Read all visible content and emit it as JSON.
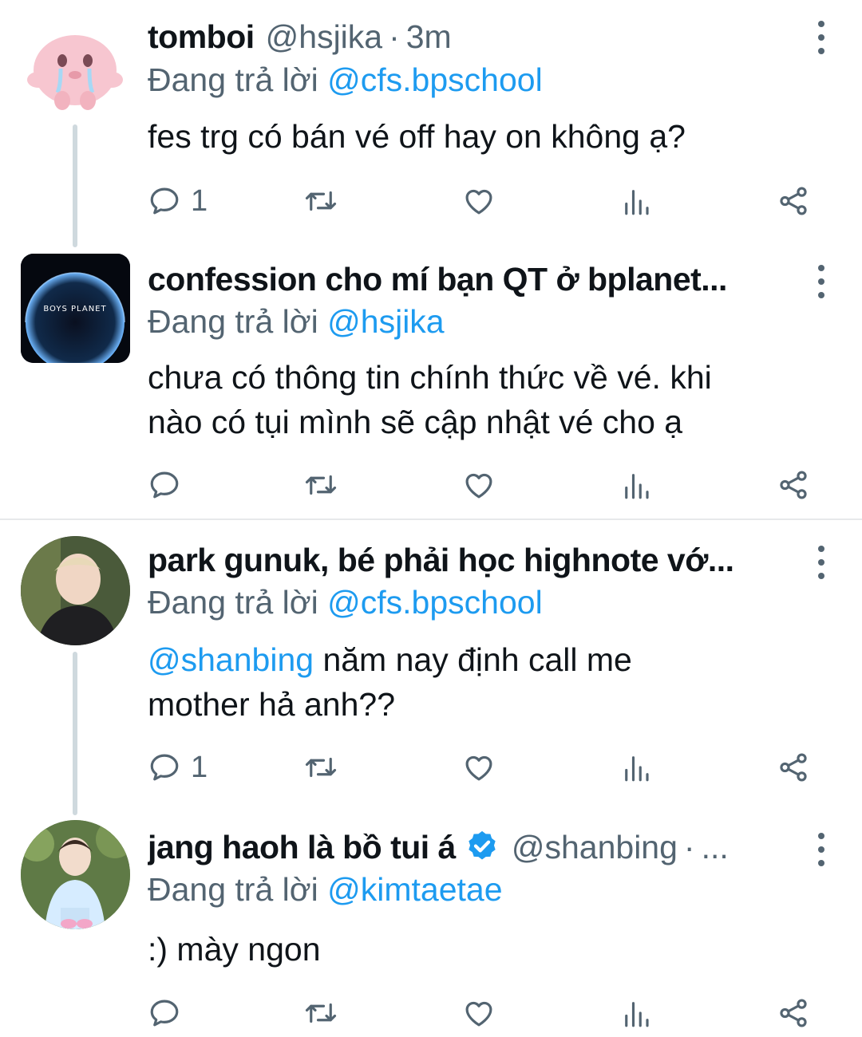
{
  "tweets": [
    {
      "name": "tomboi",
      "handle": "@hsjika",
      "dot": "·",
      "time": "3m",
      "reply_prefix": "Đang trả lời",
      "reply_to": "@cfs.bpschool",
      "text": "fes trg có bán vé off hay on không ạ?",
      "reply_count": "1"
    },
    {
      "name": "confession cho mí bạn QT ở bplanet...",
      "reply_prefix": "Đang trả lời",
      "reply_to": "@hsjika",
      "text_line1": "chưa có thông tin chính thức về vé. khi",
      "text_line2": "nào có tụi mình sẽ cập nhật vé cho ạ",
      "avatar_text": "BOYS PLANET"
    },
    {
      "name": "park gunuk, bé phải học highnote vớ...",
      "reply_prefix": "Đang trả lời",
      "reply_to": "@cfs.bpschool",
      "mention": "@shanbing",
      "text_line1_rest": " năm nay định call me",
      "text_line2": "mother hả anh??",
      "reply_count": "1"
    },
    {
      "name": "jang haoh là bồ tui á",
      "handle": "@shanbing",
      "dot": "·",
      "ellipsis": "...",
      "reply_prefix": "Đang trả lời",
      "reply_to": "@kimtaetae",
      "text": ":) mày ngon"
    }
  ],
  "icons": [
    "reply-icon",
    "retweet-icon",
    "like-icon",
    "views-icon",
    "share-icon",
    "more-icon",
    "verified-icon"
  ],
  "colors": {
    "link": "#1d9bf0",
    "muted": "#536471",
    "text": "#0f1419",
    "divider": "#e7e9ea",
    "thread": "#cfd9de"
  }
}
